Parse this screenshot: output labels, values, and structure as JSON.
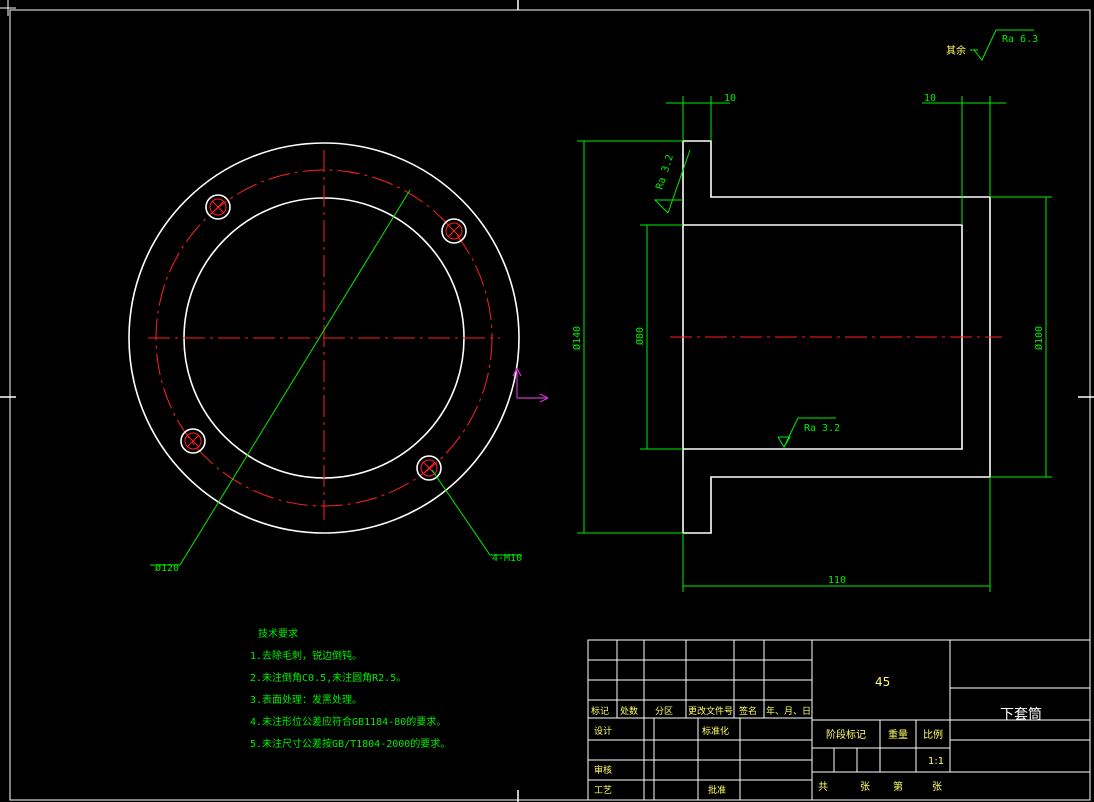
{
  "surface": {
    "label": "Ra 6.3",
    "prefix": "其余"
  },
  "front_view": {
    "bolt_circle_label": "Ø120",
    "holes_label": "4-M10"
  },
  "section_view": {
    "dim_top_left": "10",
    "dim_top_right": "10",
    "dim_outer_dia": "Ø140",
    "dim_inner_dia": "Ø80",
    "dim_body_dia": "Ø100",
    "dim_length": "110",
    "rough_top": "Ra 3.2",
    "rough_bore": "Ra 3.2"
  },
  "notes": {
    "title": "技术要求",
    "items": [
      "1.去除毛刺，锐边倒钝。",
      "2.未注倒角C0.5,未注圆角R2.5。",
      "3.表面处理：发黑处理。",
      "4.未注形位公差应符合GB1184-80的要求。",
      "5.未注尺寸公差按GB/T1804-2000的要求。"
    ]
  },
  "title_block": {
    "material": "45",
    "part_name": "下套筒",
    "header_cols": [
      "标记",
      "处数",
      "分区",
      "更改文件号",
      "签名",
      "年、月、日"
    ],
    "design": "设计",
    "standardize": "标准化",
    "review": "审核",
    "process": "工艺",
    "approve": "批准",
    "stage_mark": "阶段标记",
    "weight": "重量",
    "scale": "比例",
    "scale_value": "1:1",
    "total": "共",
    "sheets": "张",
    "page": "第",
    "sheet2": "张"
  },
  "colors": {
    "outline": "#ffffff",
    "dimension": "#00ee00",
    "center": "#ff2020",
    "hatch": "#00c8d8",
    "ucs": "#cc33cc"
  }
}
